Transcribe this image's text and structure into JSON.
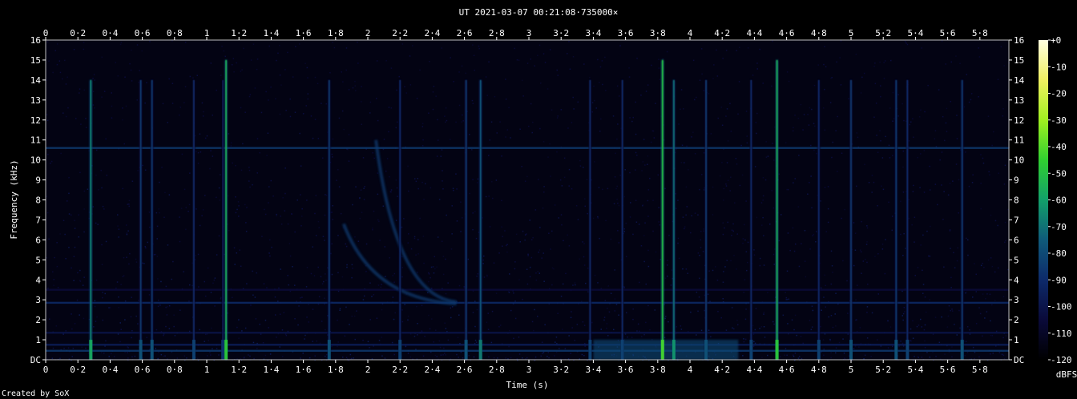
{
  "chart_data": {
    "type": "heatmap",
    "title": "UT 2021-03-07 00:21:08·735000×",
    "xlabel": "Time (s)",
    "ylabel": "Frequency (kHz)",
    "xlim": [
      0,
      5.98
    ],
    "ylim": [
      0,
      16
    ],
    "x_ticks": [
      "0",
      "0·2",
      "0·4",
      "0·6",
      "0·8",
      "1",
      "1·2",
      "1·4",
      "1·6",
      "1·8",
      "2",
      "2·2",
      "2·4",
      "2·6",
      "2·8",
      "3",
      "3·2",
      "3·4",
      "3·6",
      "3·8",
      "4",
      "4·2",
      "4·4",
      "4·6",
      "4·8",
      "5",
      "5·2",
      "5·4",
      "5·6",
      "5·8"
    ],
    "y_ticks": [
      "DC",
      "1",
      "2",
      "3",
      "4",
      "5",
      "6",
      "7",
      "8",
      "9",
      "10",
      "11",
      "12",
      "13",
      "14",
      "15",
      "16"
    ],
    "colorbar": {
      "label": "dBFS",
      "ticks": [
        "+0",
        "-10",
        "-20",
        "-30",
        "-40",
        "-50",
        "-60",
        "-70",
        "-80",
        "-90",
        "-100",
        "-110",
        "-120"
      ],
      "range": [
        -120,
        0
      ],
      "colors": [
        "#000000",
        "#0a0a3a",
        "#0d2a6a",
        "#0f5a7a",
        "#12a06a",
        "#30d030",
        "#a0f020",
        "#f0f060",
        "#ffffe0"
      ]
    },
    "background_level_dbfs": -115,
    "hum_lines_khz": [
      {
        "freq": 10.6,
        "level_dbfs": -85
      },
      {
        "freq": 2.85,
        "level_dbfs": -90
      },
      {
        "freq": 0.45,
        "level_dbfs": -85
      },
      {
        "freq": 0.75,
        "level_dbfs": -95
      },
      {
        "freq": 1.35,
        "level_dbfs": -100
      },
      {
        "freq": 3.5,
        "level_dbfs": -105
      }
    ],
    "sferics": [
      {
        "t": 0.28,
        "level_dbfs": -65,
        "top_khz": 14
      },
      {
        "t": 0.59,
        "level_dbfs": -85,
        "top_khz": 14
      },
      {
        "t": 0.66,
        "level_dbfs": -85,
        "top_khz": 14
      },
      {
        "t": 0.92,
        "level_dbfs": -90,
        "top_khz": 14
      },
      {
        "t": 1.1,
        "level_dbfs": -95,
        "top_khz": 14
      },
      {
        "t": 1.12,
        "level_dbfs": -55,
        "top_khz": 15
      },
      {
        "t": 1.76,
        "level_dbfs": -85,
        "top_khz": 14
      },
      {
        "t": 2.2,
        "level_dbfs": -90,
        "top_khz": 14
      },
      {
        "t": 2.61,
        "level_dbfs": -85,
        "top_khz": 14
      },
      {
        "t": 2.7,
        "level_dbfs": -75,
        "top_khz": 14
      },
      {
        "t": 3.38,
        "level_dbfs": -90,
        "top_khz": 14
      },
      {
        "t": 3.58,
        "level_dbfs": -90,
        "top_khz": 14
      },
      {
        "t": 3.83,
        "level_dbfs": -50,
        "top_khz": 15
      },
      {
        "t": 3.9,
        "level_dbfs": -70,
        "top_khz": 14
      },
      {
        "t": 4.1,
        "level_dbfs": -85,
        "top_khz": 14
      },
      {
        "t": 4.38,
        "level_dbfs": -90,
        "top_khz": 14
      },
      {
        "t": 4.54,
        "level_dbfs": -55,
        "top_khz": 15
      },
      {
        "t": 4.8,
        "level_dbfs": -90,
        "top_khz": 14
      },
      {
        "t": 5.0,
        "level_dbfs": -85,
        "top_khz": 14
      },
      {
        "t": 5.28,
        "level_dbfs": -85,
        "top_khz": 14
      },
      {
        "t": 5.35,
        "level_dbfs": -90,
        "top_khz": 14
      },
      {
        "t": 5.69,
        "level_dbfs": -85,
        "top_khz": 14
      }
    ],
    "whistlers": [
      {
        "t_start": 1.85,
        "f_start_khz": 6.8,
        "t_end": 2.55,
        "f_end_khz": 2.8,
        "level_dbfs": -85
      },
      {
        "t_start": 2.05,
        "f_start_khz": 11.0,
        "t_end": 2.55,
        "f_end_khz": 2.9,
        "level_dbfs": -85
      }
    ],
    "low_band_burst": {
      "t_start": 3.4,
      "t_end": 4.3,
      "f_max_khz": 1.0,
      "level_dbfs": -80
    },
    "grid": false,
    "legend": "none"
  },
  "footer": {
    "credit": "Created by SoX"
  }
}
